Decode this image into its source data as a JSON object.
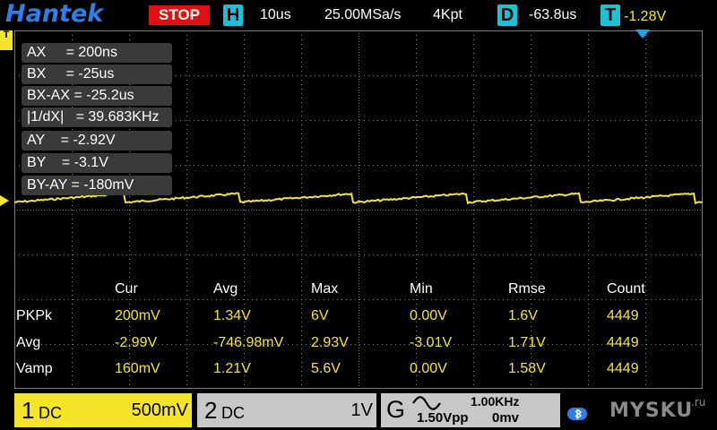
{
  "header": {
    "brand": "Hantek",
    "run_state": "STOP",
    "horizontal_badge": "H",
    "timebase": "10us",
    "sample_rate": "25.00MSa/s",
    "memory_depth": "4Kpt",
    "delay_badge": "D",
    "delay": "-63.8us",
    "trigger_badge": "T",
    "trigger_level": "-1.28V"
  },
  "markers": {
    "trigger_left_label": "T",
    "channel1_marker": "1"
  },
  "cursors": {
    "rows": [
      {
        "label": "AX     = 200ns"
      },
      {
        "label": "BX     = -25us"
      },
      {
        "label": "BX-AX = -25.2us"
      },
      {
        "label": "|1/dX|   = 39.683KHz"
      },
      {
        "label": "AY    = -2.92V"
      },
      {
        "label": "BY    = -3.1V"
      },
      {
        "label": "BY-AY = -180mV"
      }
    ]
  },
  "measurements": {
    "headers": [
      "Cur",
      "Avg",
      "Max",
      "Min",
      "Rmse",
      "Count"
    ],
    "rows": [
      {
        "name": "PKPk",
        "values": [
          "200mV",
          "1.34V",
          "6V",
          "0.00V",
          "1.6V",
          "4449"
        ]
      },
      {
        "name": "Avg",
        "values": [
          "-2.99V",
          "-746.98mV",
          "2.93V",
          "-3.01V",
          "1.71V",
          "4449"
        ]
      },
      {
        "name": "Vamp",
        "values": [
          "160mV",
          "1.21V",
          "5.6V",
          "0.00V",
          "1.58V",
          "4449"
        ]
      }
    ]
  },
  "footer": {
    "ch1": {
      "num": "1",
      "coupling": "DC",
      "scale": "500mV"
    },
    "ch2": {
      "num": "2",
      "coupling": "DC",
      "scale": "1V"
    },
    "generator": {
      "letter": "G",
      "frequency": "1.00KHz",
      "amplitude": "1.50Vpp",
      "offset": "0mv"
    },
    "watermark": "MYSKU",
    "watermark_suffix": ".ru"
  },
  "colors": {
    "trace": "#f5e52a",
    "grid": "#7a7a7a",
    "accent_cyan": "#19c2d6",
    "stop_red": "#e01010"
  }
}
